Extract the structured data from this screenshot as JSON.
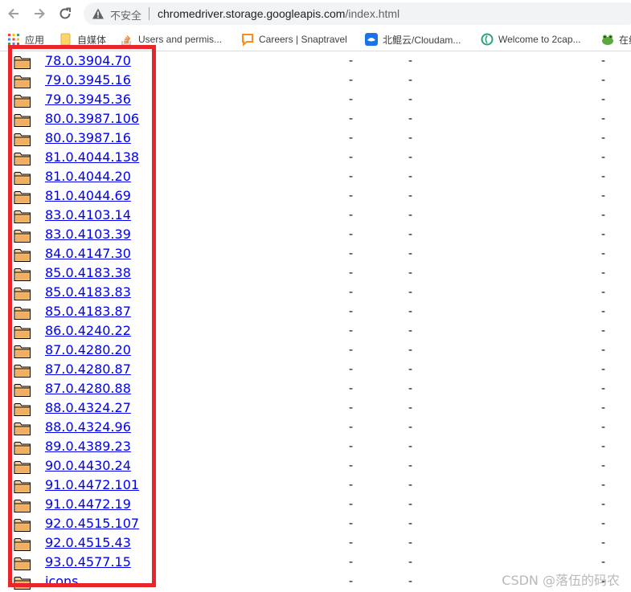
{
  "browser": {
    "security_label": "不安全",
    "url_host": "chromedriver.storage.googleapis.com",
    "url_path": "/index.html"
  },
  "bookmarks": [
    {
      "label": "应用",
      "icon": "apps-grid-icon"
    },
    {
      "label": "自媒体",
      "icon": "folder-icon"
    },
    {
      "label": "Users and permis...",
      "icon": "stackoverflow-icon"
    },
    {
      "label": "Careers | Snaptravel",
      "icon": "snaptravel-icon"
    },
    {
      "label": "北鲲云/Cloudam...",
      "icon": "cloudam-icon"
    },
    {
      "label": "Welcome to 2cap...",
      "icon": "2captcha-icon"
    },
    {
      "label": "在线",
      "icon": "frog-icon"
    }
  ],
  "listing": {
    "dash": "-",
    "entries": [
      "78.0.3904.70",
      "79.0.3945.16",
      "79.0.3945.36",
      "80.0.3987.106",
      "80.0.3987.16",
      "81.0.4044.138",
      "81.0.4044.20",
      "81.0.4044.69",
      "83.0.4103.14",
      "83.0.4103.39",
      "84.0.4147.30",
      "85.0.4183.38",
      "85.0.4183.83",
      "85.0.4183.87",
      "86.0.4240.22",
      "87.0.4280.20",
      "87.0.4280.87",
      "87.0.4280.88",
      "88.0.4324.27",
      "88.0.4324.96",
      "89.0.4389.23",
      "90.0.4430.24",
      "91.0.4472.101",
      "91.0.4472.19",
      "92.0.4515.107",
      "92.0.4515.43",
      "93.0.4577.15",
      "icons"
    ]
  },
  "highlight_color": "#e8262a",
  "watermark": "CSDN @落伍的码农"
}
